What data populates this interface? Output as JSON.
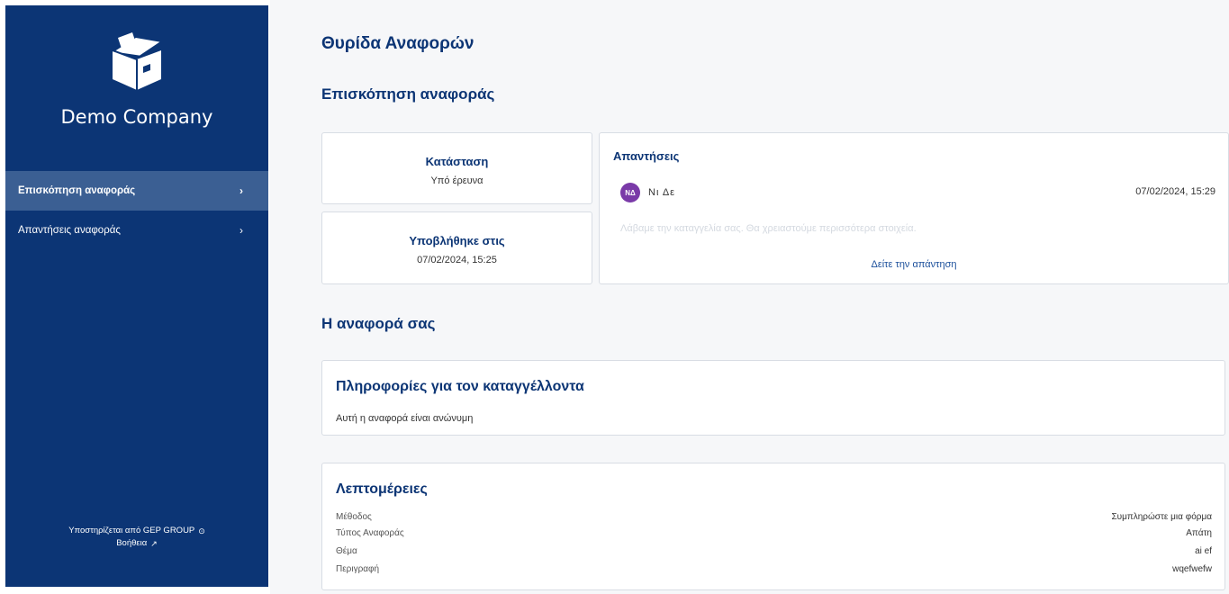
{
  "sidebar": {
    "company_name": "Demo Company",
    "logo_icon": "box-icon",
    "nav": [
      {
        "label": "Επισκόπηση αναφοράς",
        "active": true
      },
      {
        "label": "Απαντήσεις αναφοράς",
        "active": false
      }
    ],
    "footer": {
      "powered_by": "Υποστηρίζεται από GEP GROUP",
      "help": "Βοήθεια"
    }
  },
  "main": {
    "page_title": "Θυρίδα Αναφορών",
    "overview_title": "Επισκόπηση αναφοράς",
    "status": {
      "label": "Κατάσταση",
      "value": "Υπό έρευνα"
    },
    "submitted": {
      "label": "Υποβλήθηκε στις",
      "value": "07/02/2024, 15:25"
    },
    "answers": {
      "title": "Απαντήσεις",
      "avatar_initials": "ΝΔ",
      "author": "Νι    Δε",
      "date": "07/02/2024, 15:29",
      "preview": "Λάβαμε την καταγγελία σας. Θα χρειαστούμε περισσότερα στοιχεία.",
      "see_answer": "Δείτε την απάντηση"
    },
    "your_report_title": "Η αναφορά σας",
    "reporter": {
      "title": "Πληροφορίες για τον καταγγέλλοντα",
      "text": "Αυτή η αναφορά είναι ανώνυμη"
    },
    "details": {
      "title": "Λεπτομέρειες",
      "rows": [
        {
          "label": "Μέθοδος",
          "value": "Συμπληρώστε μια φόρμα"
        },
        {
          "label": "Τύπος Αναφοράς",
          "value": "Απάτη"
        },
        {
          "label": "Θέμα",
          "value": "ai  ef"
        },
        {
          "label": "Περιγραφή",
          "value": "wqefwefw"
        }
      ]
    }
  }
}
